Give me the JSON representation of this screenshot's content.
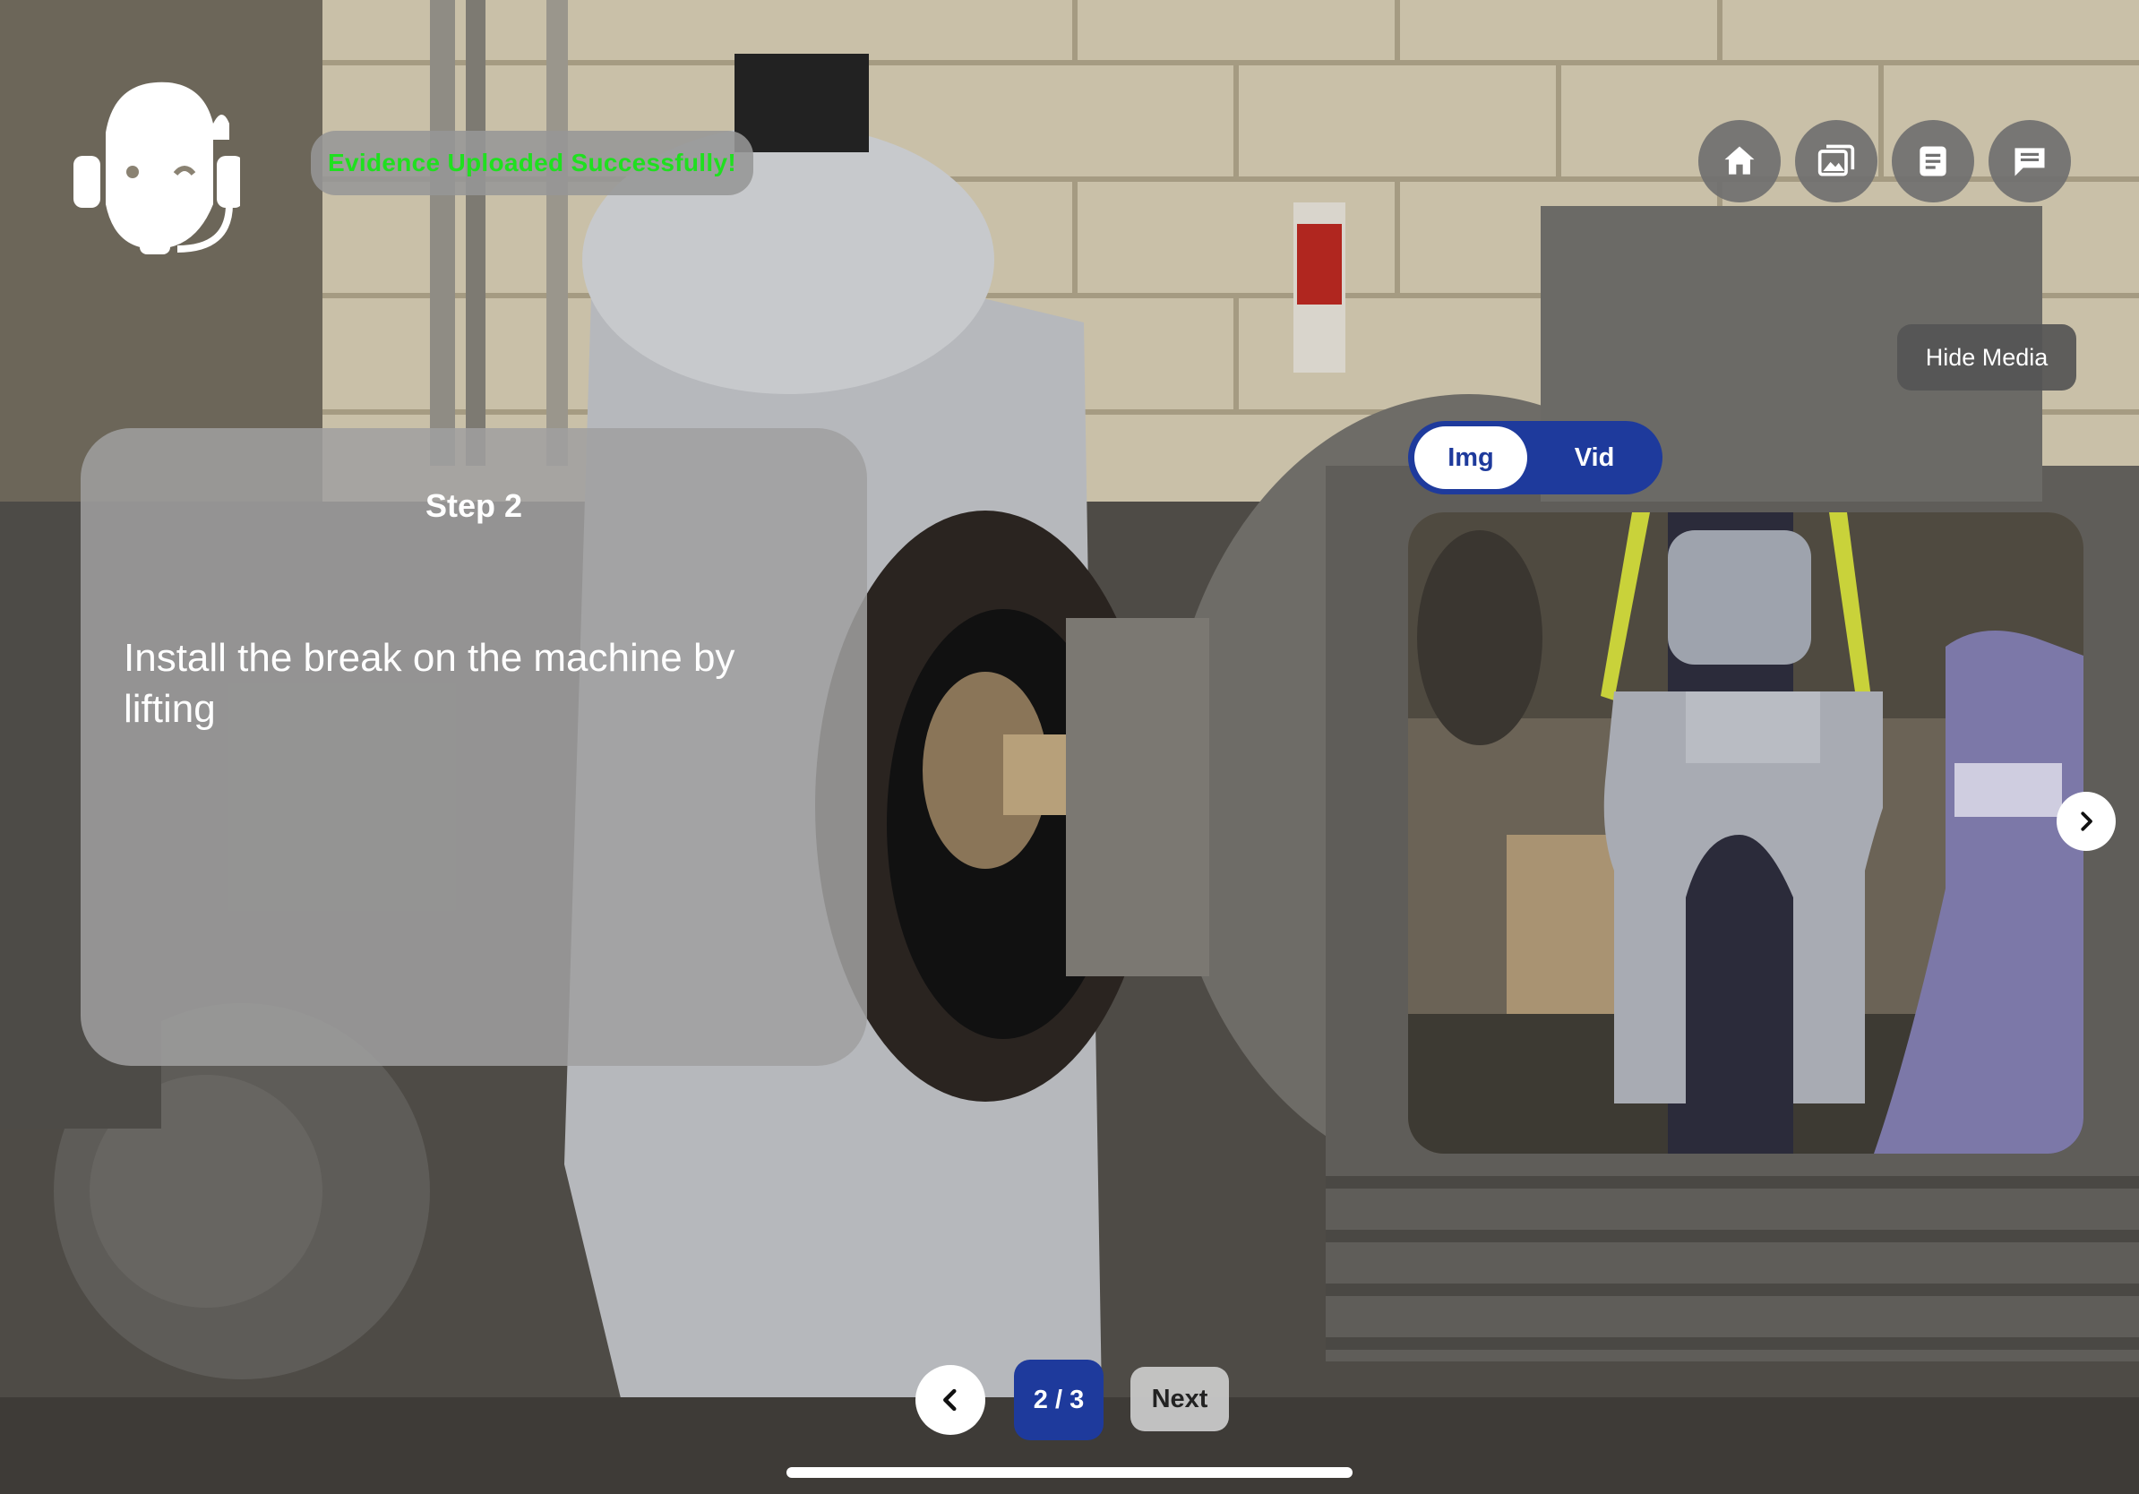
{
  "toast": {
    "message": "Evidence Uploaded Successfully!",
    "color": "#1fe01f"
  },
  "assistant": {
    "icon": "support-agent-icon"
  },
  "toolbar": {
    "buttons": [
      {
        "icon": "home-icon"
      },
      {
        "icon": "photo-library-icon"
      },
      {
        "icon": "document-icon"
      },
      {
        "icon": "chat-icon"
      }
    ]
  },
  "media": {
    "hide_label": "Hide Media",
    "toggle": {
      "img_label": "Img",
      "vid_label": "Vid",
      "selected": "Img"
    }
  },
  "step": {
    "title": "Step 2",
    "instruction": "Install the break on the machine by lifting"
  },
  "pager": {
    "current": "2 / 3",
    "next_label": "Next"
  },
  "colors": {
    "accent": "#1e3a9c",
    "toast_text": "#1fe01f",
    "card_bg": "#a0a0a0",
    "icon_button_bg": "#707070"
  }
}
